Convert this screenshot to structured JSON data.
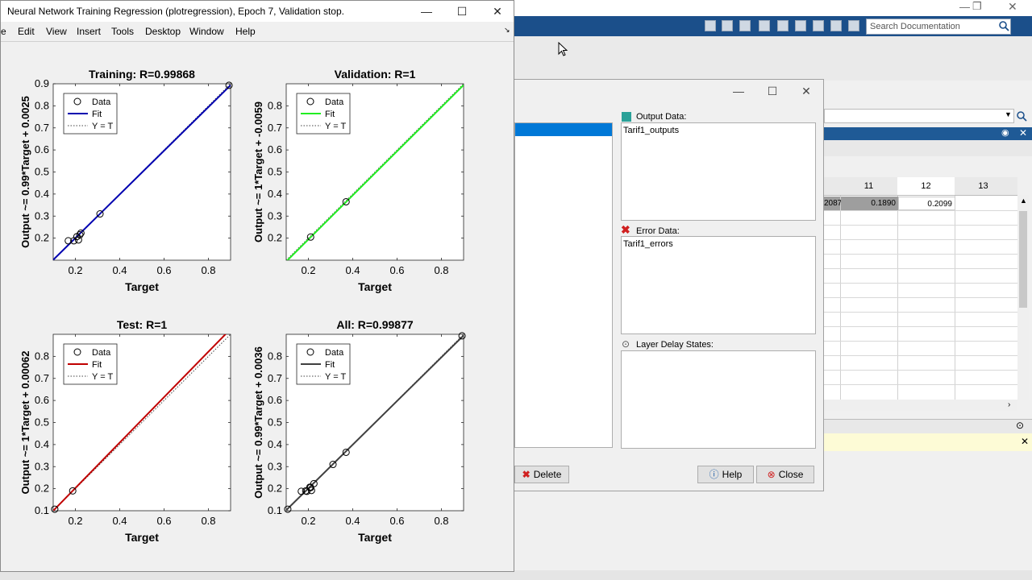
{
  "figure": {
    "title": "Neural Network Training Regression (plotregression), Epoch 7, Validation stop.",
    "menu": [
      "e",
      "Edit",
      "View",
      "Insert",
      "Tools",
      "Desktop",
      "Window",
      "Help"
    ],
    "window_controls": {
      "minimize": "—",
      "maximize": "☐",
      "close": "✕"
    }
  },
  "chart_data": [
    {
      "type": "scatter",
      "title": "Training: R=0.99868",
      "xlabel": "Target",
      "ylabel": "Output ~= 0.99*Target + 0.0025",
      "xlim": [
        0.1,
        0.9
      ],
      "ylim": [
        0.1,
        0.9
      ],
      "xticks": [
        0.2,
        0.4,
        0.6,
        0.8
      ],
      "yticks": [
        0.2,
        0.3,
        0.4,
        0.5,
        0.6,
        0.7,
        0.8,
        0.9
      ],
      "legend": [
        "Data",
        "Fit",
        "Y = T"
      ],
      "legend_position": "top-left",
      "fit_color": "#0000b0",
      "fit": {
        "slope": 0.99,
        "intercept": 0.0025
      },
      "x": [
        0.168,
        0.193,
        0.207,
        0.214,
        0.22,
        0.225,
        0.311,
        0.893
      ],
      "y": [
        0.188,
        0.188,
        0.207,
        0.192,
        0.215,
        0.223,
        0.31,
        0.893
      ]
    },
    {
      "type": "scatter",
      "title": "Validation: R=1",
      "xlabel": "Target",
      "ylabel": "Output ~= 1*Target + -0.0059",
      "xlim": [
        0.1,
        0.9
      ],
      "ylim": [
        0.1,
        0.9
      ],
      "xticks": [
        0.2,
        0.4,
        0.6,
        0.8
      ],
      "yticks": [
        0.2,
        0.3,
        0.4,
        0.5,
        0.6,
        0.7,
        0.8
      ],
      "legend": [
        "Data",
        "Fit",
        "Y = T"
      ],
      "legend_position": "top-left",
      "fit_color": "#22ee22",
      "fit": {
        "slope": 1.0,
        "intercept": -0.0059
      },
      "x": [
        0.21,
        0.37
      ],
      "y": [
        0.205,
        0.365
      ]
    },
    {
      "type": "scatter",
      "title": "Test: R=1",
      "xlabel": "Target",
      "ylabel": "Output ~= 1*Target + 0.00062",
      "xlim": [
        0.1,
        0.9
      ],
      "ylim": [
        0.1,
        0.9
      ],
      "xticks": [
        0.2,
        0.4,
        0.6,
        0.8
      ],
      "yticks": [
        0.1,
        0.2,
        0.3,
        0.4,
        0.5,
        0.6,
        0.7,
        0.8
      ],
      "legend": [
        "Data",
        "Fit",
        "Y = T"
      ],
      "legend_position": "top-left",
      "fit_color": "#c00000",
      "fit": {
        "slope": 1.03,
        "intercept": -0.003
      },
      "x": [
        0.107,
        0.188
      ],
      "y": [
        0.107,
        0.19
      ]
    },
    {
      "type": "scatter",
      "title": "All: R=0.99877",
      "xlabel": "Target",
      "ylabel": "Output ~= 0.99*Target + 0.0036",
      "xlim": [
        0.1,
        0.9
      ],
      "ylim": [
        0.1,
        0.9
      ],
      "xticks": [
        0.2,
        0.4,
        0.6,
        0.8
      ],
      "yticks": [
        0.1,
        0.2,
        0.3,
        0.4,
        0.5,
        0.6,
        0.7,
        0.8
      ],
      "legend": [
        "Data",
        "Fit",
        "Y = T"
      ],
      "legend_position": "top-left",
      "fit_color": "#404040",
      "fit": {
        "slope": 0.99,
        "intercept": 0.0036
      },
      "x": [
        0.107,
        0.168,
        0.188,
        0.193,
        0.207,
        0.21,
        0.214,
        0.225,
        0.311,
        0.37,
        0.893
      ],
      "y": [
        0.107,
        0.188,
        0.19,
        0.188,
        0.207,
        0.205,
        0.192,
        0.223,
        0.31,
        0.365,
        0.893
      ]
    }
  ],
  "dialog": {
    "output_label": "Output Data:",
    "output_value": "Tarif1_outputs",
    "error_label": "Error Data:",
    "error_value": "Tarif1_errors",
    "delay_label": "Layer Delay States:",
    "delay_value": "",
    "delete_label": "Delete",
    "help_label": "Help",
    "close_label": "Close"
  },
  "matlab": {
    "search_placeholder": "Search Documentation",
    "columns": [
      "11",
      "12",
      "13"
    ],
    "row1": [
      "2087",
      "0.1890",
      "0.2099"
    ]
  }
}
